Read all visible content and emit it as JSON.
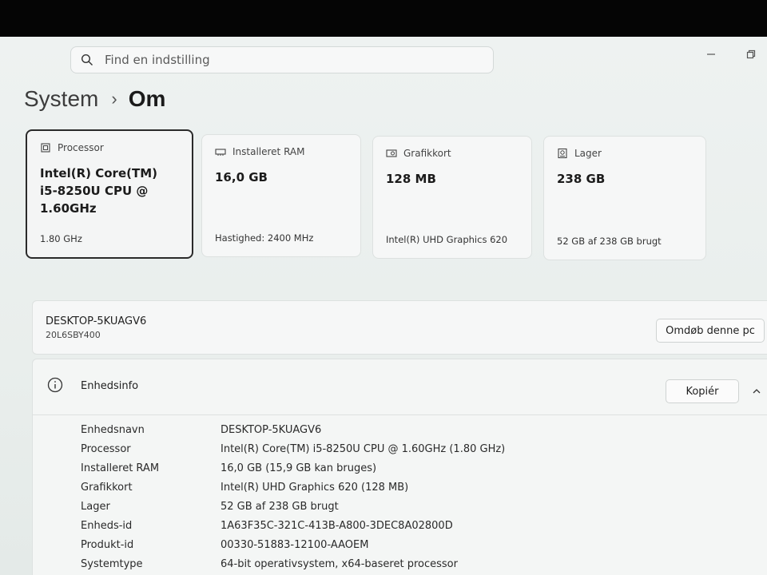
{
  "search": {
    "placeholder": "Find en indstilling"
  },
  "breadcrumb": {
    "parent": "System",
    "separator": "›",
    "current": "Om"
  },
  "cards": [
    {
      "title": "Processor",
      "value": "Intel(R) Core(TM) i5-8250U CPU @ 1.60GHz",
      "sub": "1.80 GHz",
      "icon": "cpu-icon",
      "selected": true
    },
    {
      "title": "Installeret RAM",
      "value": "16,0 GB",
      "sub": "Hastighed: 2400 MHz",
      "icon": "ram-icon"
    },
    {
      "title": "Grafikkort",
      "value": "128 MB",
      "sub": "Intel(R) UHD Graphics 620",
      "icon": "gpu-icon"
    },
    {
      "title": "Lager",
      "value": "238 GB",
      "sub": "52 GB af 238 GB brugt",
      "icon": "storage-icon"
    }
  ],
  "pc": {
    "name": "DESKTOP-5KUAGV6",
    "model": "20L6SBY400",
    "rename_label": "Omdøb denne pc"
  },
  "device_info": {
    "title": "Enhedsinfo",
    "copy_label": "Kopiér",
    "rows": [
      {
        "label": "Enhedsnavn",
        "value": "DESKTOP-5KUAGV6"
      },
      {
        "label": "Processor",
        "value": "Intel(R) Core(TM) i5-8250U CPU @ 1.60GHz (1.80 GHz)"
      },
      {
        "label": "Installeret RAM",
        "value": "16,0 GB (15,9 GB kan bruges)"
      },
      {
        "label": "Grafikkort",
        "value": "Intel(R) UHD Graphics 620 (128 MB)"
      },
      {
        "label": "Lager",
        "value": "52 GB af 238 GB brugt"
      },
      {
        "label": "Enheds-id",
        "value": "1A63F35C-321C-413B-A800-3DEC8A02800D"
      },
      {
        "label": "Produkt-id",
        "value": "00330-51883-12100-AAOEM"
      },
      {
        "label": "Systemtype",
        "value": "64-bit operativsystem, x64-baseret processor"
      }
    ]
  }
}
